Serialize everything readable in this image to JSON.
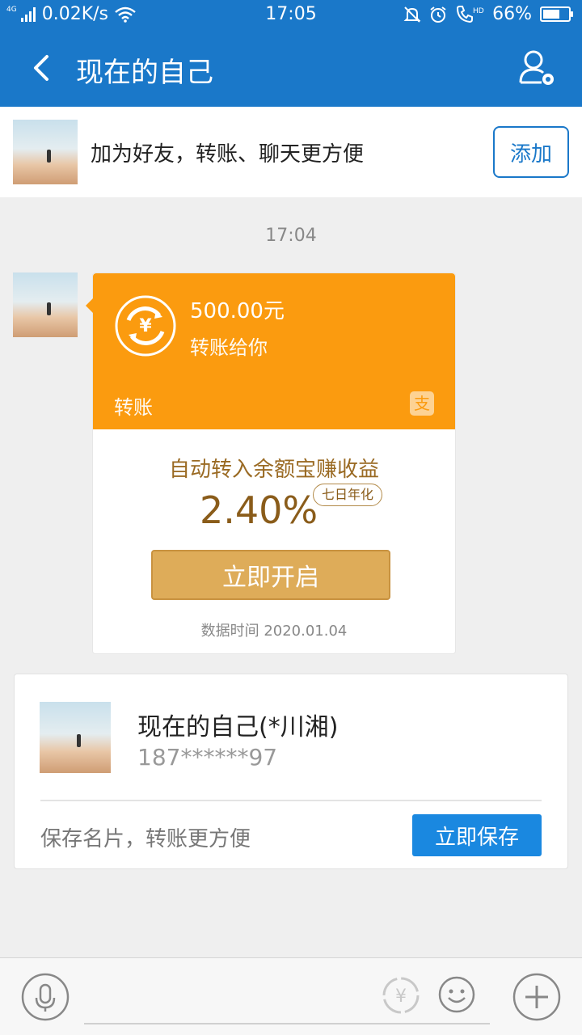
{
  "status_bar": {
    "network_type": "4G",
    "speed": "0.02K/s",
    "time": "17:05",
    "battery": "66%",
    "battery_level": 0.66,
    "volte_tag": "HD"
  },
  "header": {
    "title": "现在的自己",
    "icons": [
      "back-arrow-icon",
      "profile-settings-icon"
    ]
  },
  "add_friend_bar": {
    "text": "加为好友，转账、聊天更方便",
    "button": "添加"
  },
  "chat": {
    "timestamp": "17:04",
    "transfer": {
      "amount": "500.00元",
      "subtitle": "转账给你",
      "label": "转账",
      "promo": "自动转入余额宝赚收益",
      "rate": "2.40%",
      "rate_badge": "七日年化",
      "button": "立即开启",
      "data_time": "数据时间 2020.01.04",
      "colors": {
        "accent": "#fb9b0f",
        "gold": "#deac59"
      }
    }
  },
  "contact_card": {
    "name": "现在的自己(*川湘)",
    "phone": "187******97",
    "hint": "保存名片，转账更方便",
    "button": "立即保存"
  },
  "input_bar": {
    "icons": [
      "microphone-icon",
      "yuan-transfer-icon",
      "emoji-icon",
      "plus-icon"
    ]
  },
  "colors": {
    "brand": "#1a78c9",
    "button_blue": "#1a88e0"
  }
}
